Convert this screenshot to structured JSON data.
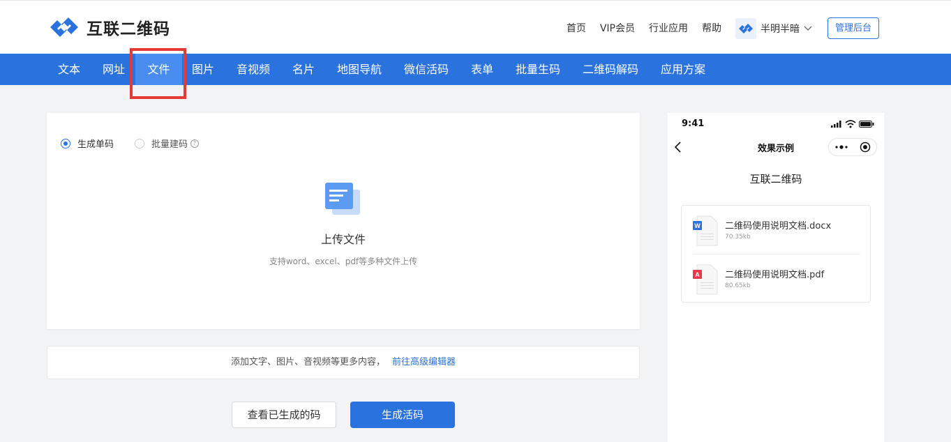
{
  "header": {
    "logo_text": "互联二维码",
    "links": [
      "首页",
      "VIP会员",
      "行业应用",
      "帮助"
    ],
    "user_name": "半明半暗",
    "admin_button": "管理后台"
  },
  "nav": {
    "items": [
      "文本",
      "网址",
      "文件",
      "图片",
      "音视频",
      "名片",
      "地图导航",
      "微信活码",
      "表单",
      "批量生码",
      "二维码解码",
      "应用方案"
    ],
    "active_index": 2
  },
  "card": {
    "radio_single": "生成单码",
    "radio_batch": "批量建码",
    "help_symbol": "?",
    "upload_title": "上传文件",
    "upload_hint": "支持word、excel、pdf等多种文件上传"
  },
  "editor_bar": {
    "text": "添加文字、图片、音视频等更多内容，",
    "link": "前往高级编辑器"
  },
  "buttons": {
    "view": "查看已生成的码",
    "generate": "生成活码"
  },
  "phone": {
    "time": "9:41",
    "title": "效果示例",
    "brand": "互联二维码",
    "files": [
      {
        "name": "二维码使用说明文档.docx",
        "size": "70.35kb",
        "type": "word",
        "badge": "W"
      },
      {
        "name": "二维码使用说明文档.pdf",
        "size": "80.65kb",
        "type": "pdf",
        "badge": "A"
      }
    ]
  },
  "colors": {
    "primary": "#2a72de",
    "active_tab": "#4a8df0",
    "highlight": "#e53935",
    "word": "#2a72de",
    "pdf": "#e8394d"
  }
}
